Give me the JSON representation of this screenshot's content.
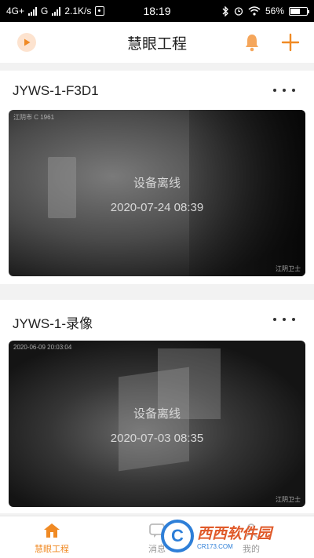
{
  "status_bar": {
    "network": "4G+",
    "carrier": "G",
    "speed": "2.1K/s",
    "time": "18:19",
    "battery": "56%"
  },
  "header": {
    "title": "慧眼工程",
    "icons": [
      "play-icon",
      "bell-icon",
      "plus-icon"
    ],
    "accent": "#f08a24"
  },
  "devices": [
    {
      "name": "JYWS-1-F3D1",
      "status": "设备离线",
      "last_time": "2020-07-24 08:39",
      "stamp": "江阴市 C 1961",
      "watermark": "江阴卫士"
    },
    {
      "name": "JYWS-1-录像",
      "status": "设备离线",
      "last_time": "2020-07-03 08:35",
      "stamp": "2020-06-09 20:03:04",
      "watermark": "江阴卫士"
    }
  ],
  "tabs": [
    {
      "label": "慧眼工程",
      "icon": "home-icon",
      "active": true
    },
    {
      "label": "消息",
      "icon": "message-icon",
      "active": false
    },
    {
      "label": "我的",
      "icon": "user-icon",
      "active": false
    }
  ],
  "watermark_logo": {
    "brand": "西西软件园",
    "sub": "CR173.COM"
  }
}
